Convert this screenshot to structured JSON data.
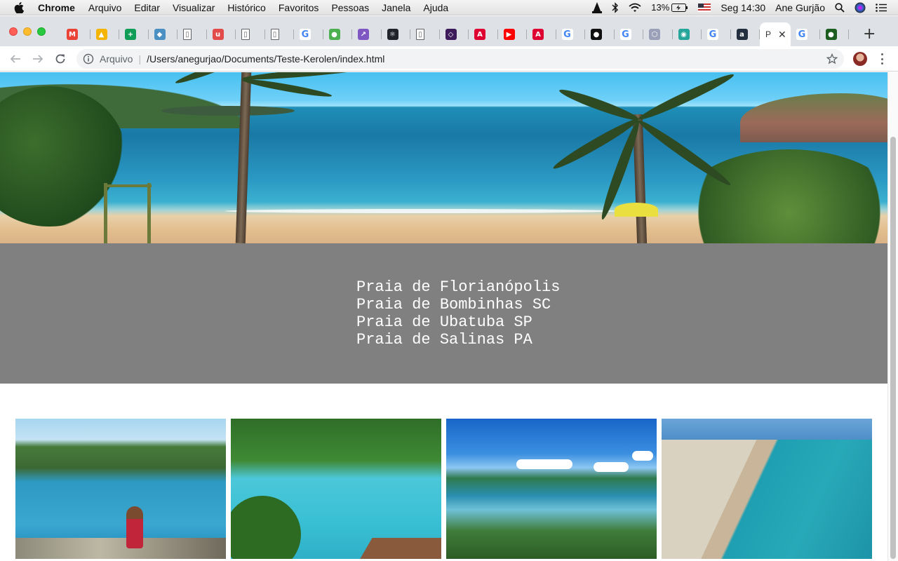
{
  "menubar": {
    "app_name": "Chrome",
    "menus": [
      "Arquivo",
      "Editar",
      "Visualizar",
      "Histórico",
      "Favoritos",
      "Pessoas",
      "Janela",
      "Ajuda"
    ],
    "battery": "13%",
    "clock": "Seg 14:30",
    "user": "Ane Gurjão"
  },
  "tabs": {
    "count_visible": 27,
    "items": [
      {
        "icon": "gmail-icon",
        "color": "#ea4335",
        "glyph": "M"
      },
      {
        "icon": "drive-icon",
        "color": "#f4b400",
        "glyph": "▲"
      },
      {
        "icon": "sheets-icon",
        "color": "#0f9d58",
        "glyph": "+"
      },
      {
        "icon": "colab-icon",
        "color": "#4a90c2",
        "glyph": "◆"
      },
      {
        "icon": "doc-icon",
        "color": "#5f6368",
        "glyph": "▯"
      },
      {
        "icon": "acrobat-icon",
        "color": "#e34b4b",
        "glyph": "u"
      },
      {
        "icon": "doc-icon",
        "color": "#5f6368",
        "glyph": "▯"
      },
      {
        "icon": "doc-search-icon",
        "color": "#5f6368",
        "glyph": "▯"
      },
      {
        "icon": "google-icon",
        "color": "#4285f4",
        "glyph": "G"
      },
      {
        "icon": "green-circle-icon",
        "color": "#4caf50",
        "glyph": "●"
      },
      {
        "icon": "purple-app-icon",
        "color": "#7e57c2",
        "glyph": "↗"
      },
      {
        "icon": "react-icon",
        "color": "#20232a",
        "glyph": "⚛"
      },
      {
        "icon": "doc-icon",
        "color": "#5f6368",
        "glyph": "▯"
      },
      {
        "icon": "shield-icon",
        "color": "#3d1b5a",
        "glyph": "◇"
      },
      {
        "icon": "angular-icon",
        "color": "#dd0031",
        "glyph": "A"
      },
      {
        "icon": "youtube-icon",
        "color": "#ff0000",
        "glyph": "▶"
      },
      {
        "icon": "angular-icon",
        "color": "#dd0031",
        "glyph": "A"
      },
      {
        "icon": "google-icon",
        "color": "#4285f4",
        "glyph": "G"
      },
      {
        "icon": "github-icon",
        "color": "#111111",
        "glyph": "●"
      },
      {
        "icon": "google-icon",
        "color": "#4285f4",
        "glyph": "G"
      },
      {
        "icon": "hexagon-icon",
        "color": "#9aa0b8",
        "glyph": "⬡"
      },
      {
        "icon": "eye-icon",
        "color": "#26a69a",
        "glyph": "◉"
      },
      {
        "icon": "google-icon",
        "color": "#4285f4",
        "glyph": "G"
      },
      {
        "icon": "amazon-icon",
        "color": "#232f3e",
        "glyph": "a"
      }
    ],
    "active": {
      "label": "P",
      "close": "✕"
    },
    "after_active": [
      {
        "icon": "google-icon",
        "color": "#4285f4",
        "glyph": "G"
      },
      {
        "icon": "green-orb-icon",
        "color": "#1b5e20",
        "glyph": "●"
      }
    ],
    "new_tab": "+"
  },
  "toolbar": {
    "scheme_label": "Arquivo",
    "separator": "|",
    "url": "/Users/anegurjao/Documents/Teste-Kerolen/index.html"
  },
  "page": {
    "beaches": [
      "Praia de Florianópolis",
      "Praia de Bombinhas SC",
      "Praia de Ubatuba SP",
      "Praia de Salinas PA"
    ],
    "colors": {
      "band": "#808080",
      "band_text": "#ffffff"
    }
  }
}
